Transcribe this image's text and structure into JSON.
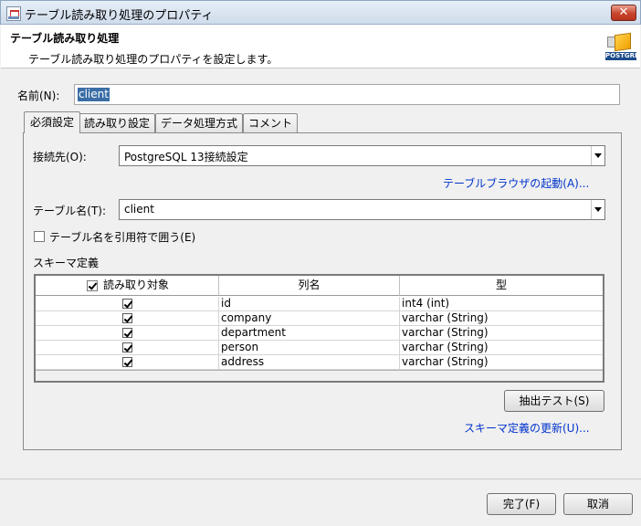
{
  "window": {
    "title": "テーブル読み取り処理のプロパティ",
    "close_label": "✕"
  },
  "header": {
    "title": "テーブル読み取り処理",
    "description": "テーブル読み取り処理のプロパティを設定します。",
    "icon_label": "POSTGRE"
  },
  "name": {
    "label": "名前(N):",
    "value": "client"
  },
  "tabs": [
    {
      "label": "必須設定",
      "selected": true
    },
    {
      "label": "読み取り設定",
      "selected": false
    },
    {
      "label": "データ処理方式",
      "selected": false
    },
    {
      "label": "コメント",
      "selected": false
    }
  ],
  "connection": {
    "label": "接続先(O):",
    "value": "PostgreSQL 13接続設定"
  },
  "browser_link": "テーブルブラウザの起動(A)...",
  "table": {
    "label": "テーブル名(T):",
    "value": "client"
  },
  "quote_option": {
    "label": "テーブル名を引用符で囲う(E)",
    "checked": false
  },
  "schema": {
    "label": "スキーマ定義",
    "header_checked": true,
    "columns": [
      "読み取り対象",
      "列名",
      "型"
    ],
    "rows": [
      {
        "checked": true,
        "name": "id",
        "type": "int4 (int)"
      },
      {
        "checked": true,
        "name": "company",
        "type": "varchar (String)"
      },
      {
        "checked": true,
        "name": "department",
        "type": "varchar (String)"
      },
      {
        "checked": true,
        "name": "person",
        "type": "varchar (String)"
      },
      {
        "checked": true,
        "name": "address",
        "type": "varchar (String)"
      }
    ]
  },
  "extract_test_label": "抽出テスト(S)",
  "schema_update_link": "スキーマ定義の更新(U)...",
  "footer": {
    "finish_label": "完了(F)",
    "cancel_label": "取消"
  },
  "colors": {
    "link": "#0033cc",
    "selection": "#3a6ea5"
  }
}
